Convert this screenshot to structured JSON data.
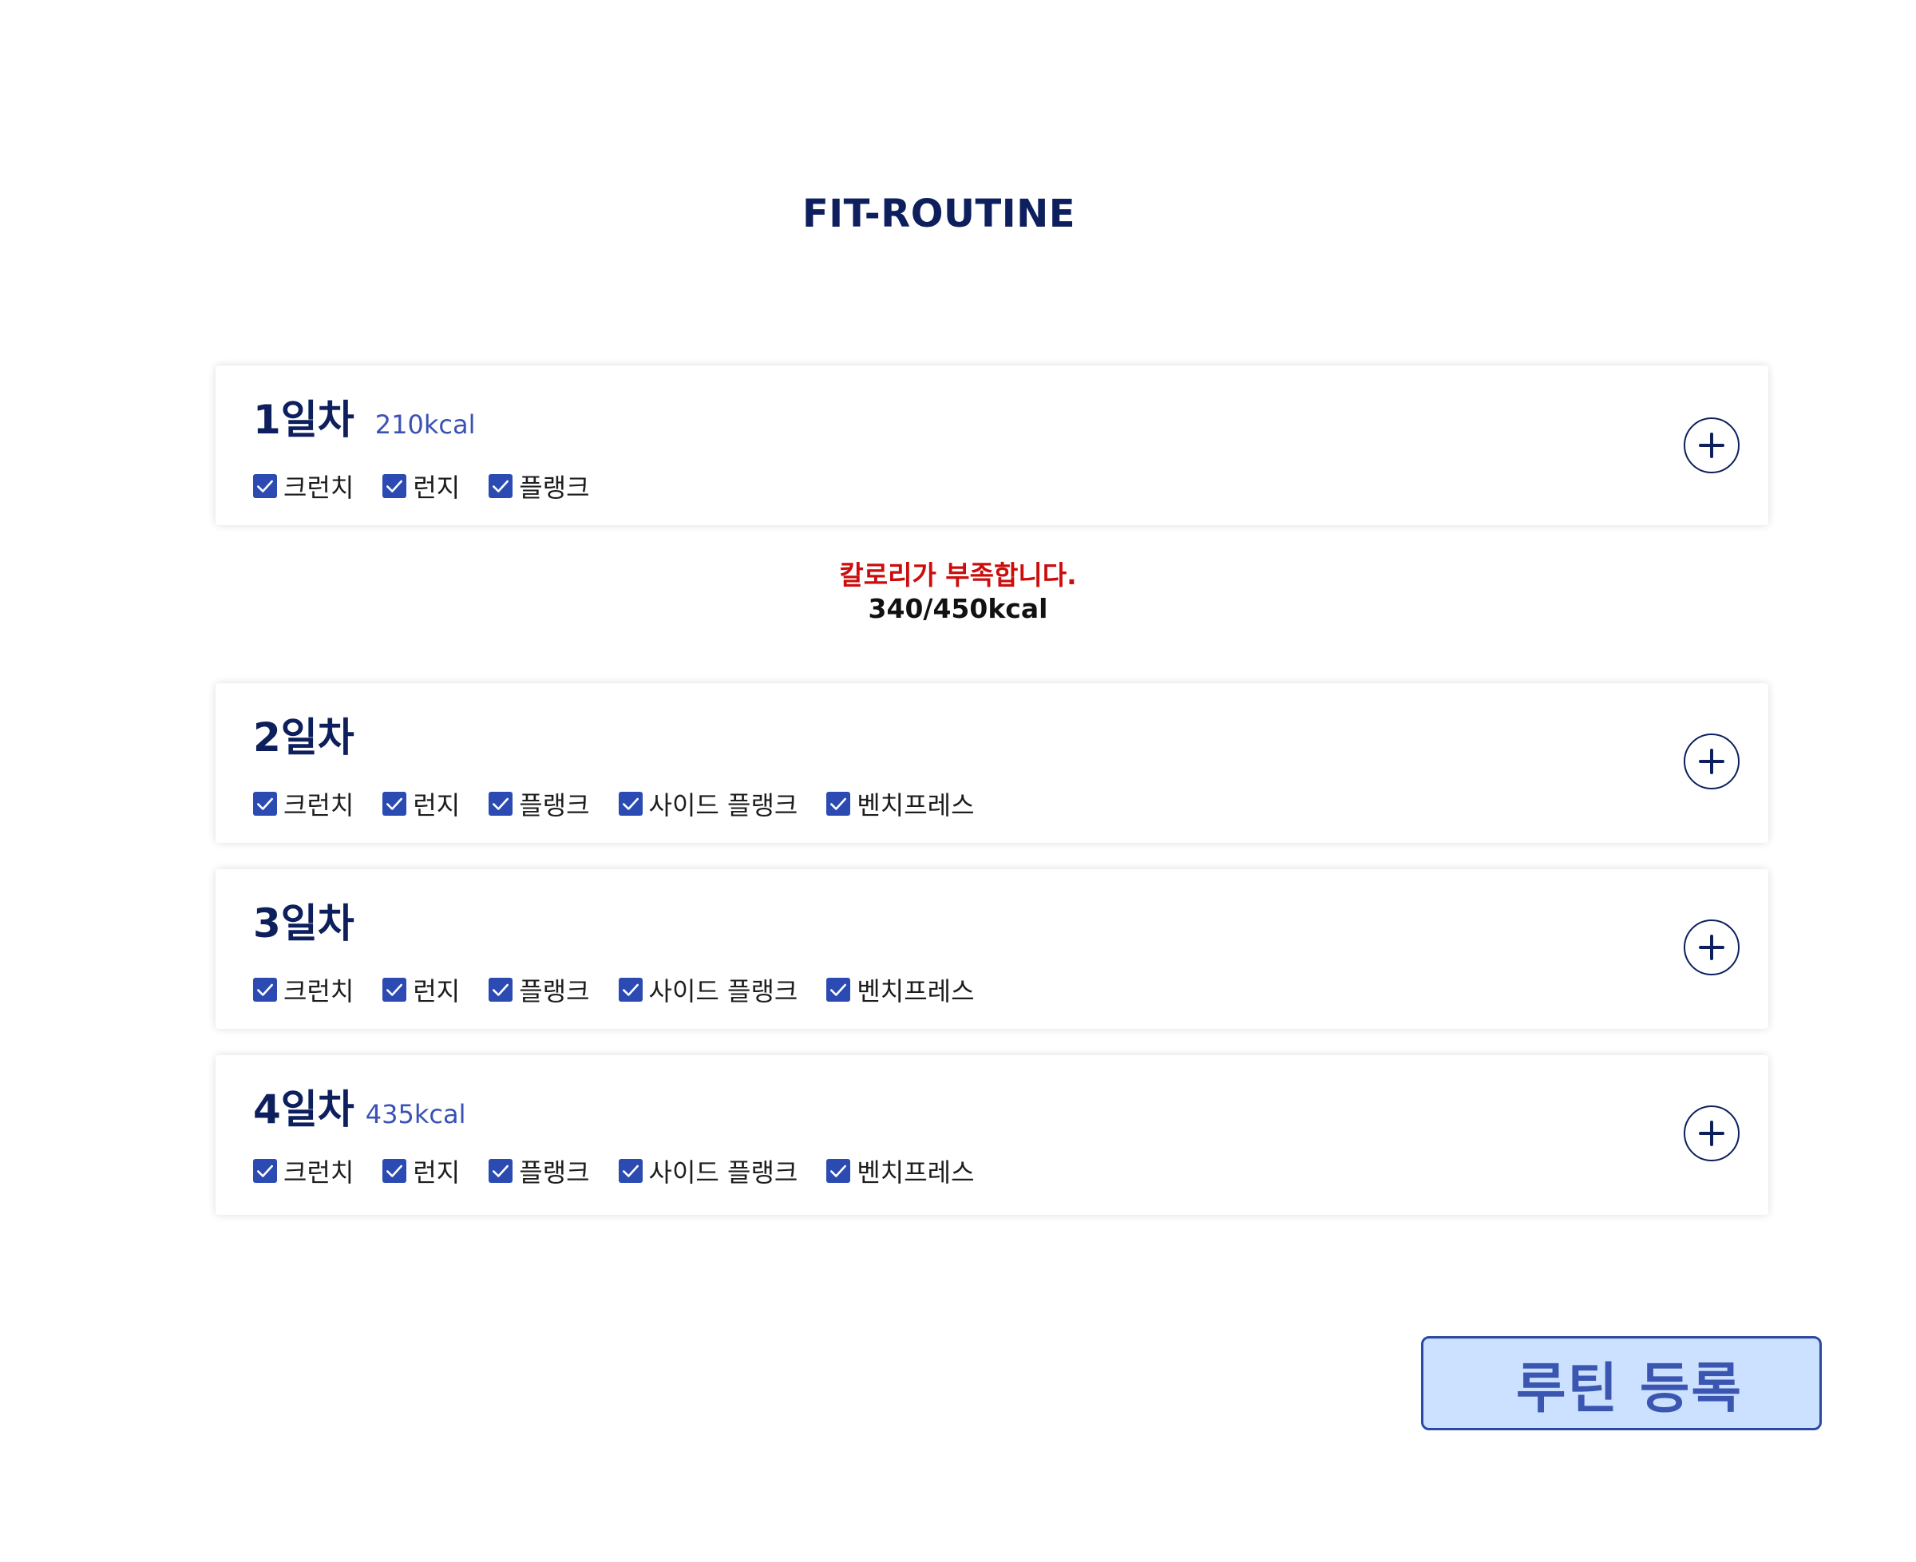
{
  "app": {
    "title": "FIT-ROUTINE"
  },
  "days": [
    {
      "title": "1일차",
      "kcal": "210kcal",
      "exercises": [
        "크런치",
        "런지",
        "플랭크"
      ]
    },
    {
      "title": "2일차",
      "kcal": "",
      "exercises": [
        "크런치",
        "런지",
        "플랭크",
        "사이드 플랭크",
        "벤치프레스"
      ]
    },
    {
      "title": "3일차",
      "kcal": "",
      "exercises": [
        "크런치",
        "런지",
        "플랭크",
        "사이드 플랭크",
        "벤치프레스"
      ]
    },
    {
      "title": "4일차",
      "kcal": "435kcal",
      "exercises": [
        "크런치",
        "런지",
        "플랭크",
        "사이드 플랭크",
        "벤치프레스"
      ]
    }
  ],
  "warning": {
    "message": "칼로리가 부족합니다.",
    "total": "340/450kcal"
  },
  "register_button": {
    "label": "루틴 등록"
  },
  "icons": {
    "checkbox": "check-icon",
    "add": "plus-icon"
  },
  "colors": {
    "primary": "#0d1f5c",
    "accent": "#2b4bb3",
    "kcal": "#3a52b4",
    "warning": "#cc0d0d",
    "button_bg": "#cce0ff"
  }
}
